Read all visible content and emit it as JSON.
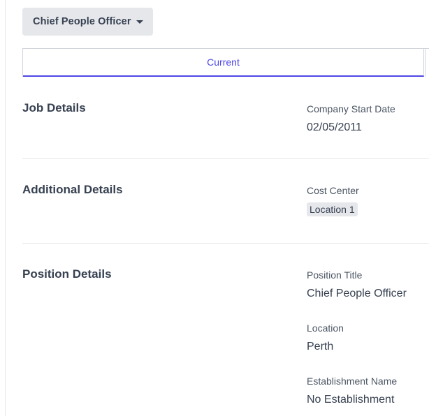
{
  "role_selector": {
    "label": "Chief People Officer"
  },
  "tabs": {
    "current": "Current"
  },
  "sections": {
    "job_details": {
      "title": "Job Details",
      "company_start_date_label": "Company Start Date",
      "company_start_date_value": "02/05/2011"
    },
    "additional_details": {
      "title": "Additional Details",
      "cost_center_label": "Cost Center",
      "cost_center_value": "Location 1"
    },
    "position_details": {
      "title": "Position Details",
      "position_title_label": "Position Title",
      "position_title_value": "Chief People Officer",
      "location_label": "Location",
      "location_value": "Perth",
      "establishment_name_label": "Establishment Name",
      "establishment_name_value": "No Establishment"
    }
  },
  "colors": {
    "accent": "#4f46e5",
    "dropdown_bg": "#e5e7eb",
    "text": "#374151",
    "divider": "#e5e7eb"
  },
  "icons": {
    "dropdown": "caret-down-icon"
  }
}
